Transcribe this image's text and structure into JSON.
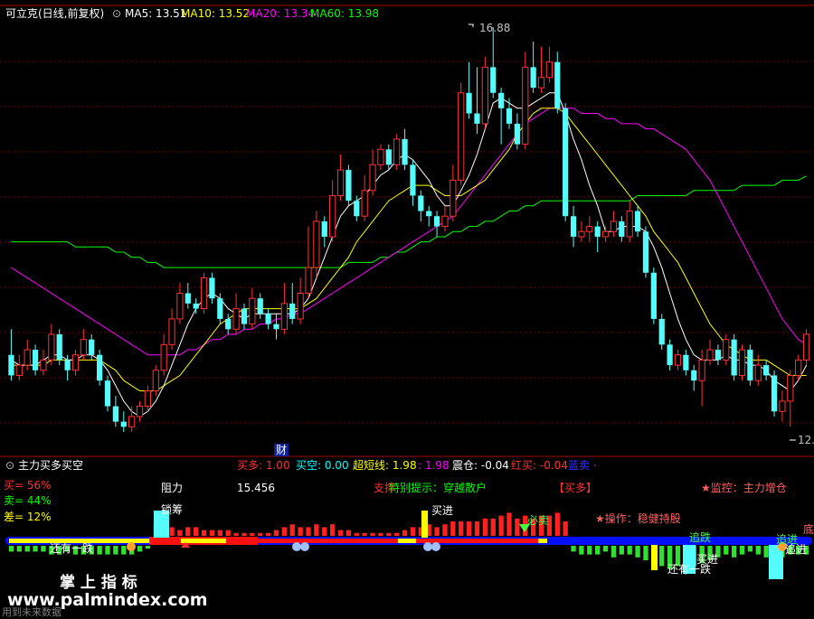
{
  "main_header": {
    "title": "可立克(日线,前复权)",
    "ma5": "MA5: 13.51",
    "ma10": "MA10: 13.52",
    "ma20": "MA20: 13.34",
    "ma60": "MA60: 13.98"
  },
  "sub_header": {
    "title": "主力买多买空",
    "items": [
      {
        "text": "买多: 1.00",
        "color": "#ff3030"
      },
      {
        "text": "买空: 0.00",
        "color": "#00ffff"
      },
      {
        "text": "超短线: 1.98",
        "color": "#ffff00"
      },
      {
        "text": ": 1.98",
        "color": "#ff00ff"
      },
      {
        "text": "震仓: -0.04",
        "color": "#ffffff"
      },
      {
        "text": "红买: -0.04",
        "color": "#ff3030"
      },
      {
        "text": "蓝卖",
        "color": "#3030ff"
      },
      {
        "text": "·",
        "color": "#ff00ff"
      }
    ]
  },
  "left_stats": {
    "buy": "买= 56%",
    "sell": "卖= 44%",
    "diff": "差= 12%"
  },
  "labels": {
    "resistance_label": "阻力",
    "resistance_value": "15.456",
    "support_label": "支撑",
    "hint": "特别提示：穿越散户",
    "buy_more": "【买多】",
    "monitor": "★监控：主力增仓",
    "operate": "★操作：稳健持股",
    "tag_finance": "财",
    "tag_buy_in_1": "买进",
    "tag_must_sell": "必卖",
    "tag_buy_in_2": "买进",
    "tag_still_fall_1": "还有一跌",
    "tag_still_fall_2": "还有一跌",
    "tag_chase": "追跌",
    "tag_chase_in": "追进",
    "tag_right_1": "追进",
    "tag_right_2": "底",
    "tag_lock": "锁筹",
    "watermark_title": "掌 上 指 标",
    "watermark_url": "www.palmindex.com",
    "footer": "用到未来数据"
  },
  "chart_data": {
    "type": "candlestick",
    "title": "可立克(日线,前复权)",
    "annotations": [
      {
        "text": "16.88",
        "kind": "high"
      },
      {
        "text": "12.",
        "kind": "low"
      }
    ],
    "colors": {
      "up": "#ff3232",
      "down": "#54fcfc",
      "ma5": "#ffffff",
      "ma10": "#ffff00",
      "ma20": "#ff00ff",
      "ma60": "#00ff00"
    },
    "candles": [
      [
        10.5,
        10.1,
        11.0,
        10.0
      ],
      [
        10.1,
        10.3,
        10.5,
        10.0
      ],
      [
        10.3,
        10.6,
        10.8,
        10.2
      ],
      [
        10.6,
        10.2,
        10.7,
        10.1
      ],
      [
        10.2,
        10.4,
        10.6,
        10.1
      ],
      [
        10.4,
        10.9,
        11.1,
        10.3
      ],
      [
        10.9,
        10.4,
        11.0,
        10.3
      ],
      [
        10.4,
        10.2,
        10.5,
        10.0
      ],
      [
        10.2,
        10.5,
        10.6,
        10.1
      ],
      [
        10.5,
        10.8,
        11.0,
        10.4
      ],
      [
        10.8,
        10.5,
        10.9,
        10.4
      ],
      [
        10.5,
        10.0,
        10.6,
        9.9
      ],
      [
        10.0,
        9.5,
        10.1,
        9.4
      ],
      [
        9.5,
        9.2,
        9.7,
        9.1
      ],
      [
        9.2,
        9.1,
        9.4,
        9.0
      ],
      [
        9.1,
        9.3,
        9.5,
        9.0
      ],
      [
        9.3,
        9.5,
        9.6,
        9.2
      ],
      [
        9.5,
        9.8,
        9.9,
        9.4
      ],
      [
        9.8,
        10.2,
        10.3,
        9.7
      ],
      [
        10.2,
        10.7,
        10.9,
        10.1
      ],
      [
        10.7,
        11.2,
        11.4,
        10.6
      ],
      [
        11.2,
        11.7,
        11.9,
        11.1
      ],
      [
        11.7,
        11.5,
        11.9,
        11.4
      ],
      [
        11.5,
        11.4,
        11.6,
        11.3
      ],
      [
        11.4,
        12.0,
        12.1,
        11.3
      ],
      [
        12.0,
        11.6,
        12.1,
        11.5
      ],
      [
        11.6,
        11.2,
        11.7,
        11.1
      ],
      [
        11.2,
        11.0,
        11.3,
        10.9
      ],
      [
        11.0,
        11.4,
        11.7,
        10.9
      ],
      [
        11.4,
        11.1,
        11.5,
        11.0
      ],
      [
        11.1,
        11.6,
        11.8,
        11.0
      ],
      [
        11.6,
        11.3,
        11.7,
        11.2
      ],
      [
        11.3,
        11.1,
        11.4,
        11.0
      ],
      [
        11.1,
        11.0,
        11.3,
        10.8
      ],
      [
        11.0,
        11.5,
        11.9,
        10.9
      ],
      [
        11.5,
        11.2,
        11.9,
        11.1
      ],
      [
        11.2,
        11.7,
        12.0,
        11.1
      ],
      [
        11.7,
        12.2,
        13.0,
        11.6
      ],
      [
        12.2,
        13.1,
        13.3,
        12.0
      ],
      [
        13.1,
        12.8,
        13.2,
        12.6
      ],
      [
        12.8,
        13.6,
        13.9,
        12.7
      ],
      [
        13.6,
        14.1,
        14.4,
        13.5
      ],
      [
        14.1,
        13.5,
        14.2,
        13.4
      ],
      [
        13.5,
        13.2,
        13.6,
        13.1
      ],
      [
        13.2,
        13.7,
        14.0,
        13.1
      ],
      [
        13.7,
        14.2,
        14.5,
        13.6
      ],
      [
        14.2,
        14.5,
        14.6,
        14.1
      ],
      [
        14.5,
        14.2,
        14.6,
        14.1
      ],
      [
        14.2,
        14.7,
        14.8,
        14.1
      ],
      [
        14.7,
        14.2,
        14.9,
        14.1
      ],
      [
        14.2,
        13.6,
        14.3,
        13.4
      ],
      [
        13.6,
        13.3,
        13.7,
        13.1
      ],
      [
        13.3,
        13.2,
        13.4,
        13.0
      ],
      [
        13.2,
        13.0,
        13.3,
        12.8
      ],
      [
        13.0,
        13.2,
        13.4,
        12.9
      ],
      [
        13.2,
        13.9,
        14.2,
        13.1
      ],
      [
        13.9,
        15.6,
        15.8,
        13.8
      ],
      [
        15.6,
        15.2,
        16.2,
        15.1
      ],
      [
        15.2,
        15.0,
        16.1,
        14.8
      ],
      [
        15.0,
        16.1,
        16.3,
        14.9
      ],
      [
        16.1,
        15.6,
        16.88,
        15.5
      ],
      [
        15.6,
        15.3,
        15.7,
        14.6
      ],
      [
        15.3,
        15.0,
        15.5,
        14.9
      ],
      [
        15.0,
        14.6,
        15.2,
        14.5
      ],
      [
        14.6,
        16.1,
        16.4,
        14.5
      ],
      [
        16.1,
        15.7,
        16.6,
        15.6
      ],
      [
        15.7,
        15.9,
        16.5,
        15.6
      ],
      [
        15.9,
        16.2,
        16.5,
        15.8
      ],
      [
        16.2,
        15.3,
        16.4,
        15.2
      ],
      [
        15.3,
        13.2,
        15.4,
        13.1
      ],
      [
        13.2,
        12.8,
        13.4,
        12.6
      ],
      [
        12.8,
        12.9,
        13.1,
        12.7
      ],
      [
        12.9,
        13.0,
        13.2,
        12.7
      ],
      [
        13.0,
        12.8,
        13.1,
        12.5
      ],
      [
        12.8,
        12.9,
        13.0,
        12.7
      ],
      [
        12.9,
        13.1,
        13.3,
        12.8
      ],
      [
        13.1,
        12.8,
        13.2,
        12.7
      ],
      [
        12.8,
        13.3,
        13.5,
        12.7
      ],
      [
        13.3,
        12.9,
        13.4,
        12.8
      ],
      [
        12.9,
        12.1,
        13.0,
        12.0
      ],
      [
        12.1,
        11.2,
        12.2,
        11.1
      ],
      [
        11.2,
        10.7,
        11.3,
        10.6
      ],
      [
        10.7,
        10.3,
        10.8,
        10.2
      ],
      [
        10.3,
        10.5,
        10.6,
        10.2
      ],
      [
        10.5,
        10.2,
        10.6,
        10.1
      ],
      [
        10.2,
        10.0,
        10.3,
        9.8
      ],
      [
        10.0,
        10.4,
        10.6,
        9.5
      ],
      [
        10.4,
        10.6,
        10.8,
        10.3
      ],
      [
        10.6,
        10.4,
        10.7,
        10.3
      ],
      [
        10.4,
        10.8,
        10.9,
        10.3
      ],
      [
        10.8,
        10.1,
        10.9,
        10.0
      ],
      [
        10.1,
        10.6,
        10.7,
        10.0
      ],
      [
        10.6,
        10.0,
        10.7,
        9.9
      ],
      [
        10.0,
        10.3,
        10.5,
        9.9
      ],
      [
        10.3,
        10.1,
        10.4,
        10.0
      ],
      [
        10.1,
        9.4,
        10.2,
        9.3
      ],
      [
        9.4,
        9.6,
        9.8,
        9.2
      ],
      [
        9.6,
        10.1,
        10.2,
        9.1
      ],
      [
        10.1,
        10.4,
        10.5,
        10.0
      ],
      [
        10.4,
        10.9,
        11.0,
        10.3
      ]
    ],
    "ma5": [
      10.4,
      10.3,
      10.3,
      10.3,
      10.4,
      10.5,
      10.5,
      10.4,
      10.4,
      10.5,
      10.5,
      10.4,
      10.2,
      9.9,
      9.6,
      9.4,
      9.3,
      9.4,
      9.6,
      9.9,
      10.3,
      10.7,
      11.1,
      11.4,
      11.6,
      11.7,
      11.6,
      11.4,
      11.3,
      11.2,
      11.3,
      11.3,
      11.3,
      11.3,
      11.3,
      11.3,
      11.4,
      11.6,
      12.0,
      12.4,
      12.8,
      13.2,
      13.4,
      13.5,
      13.6,
      13.8,
      14.0,
      14.1,
      14.3,
      14.4,
      14.3,
      14.1,
      13.9,
      13.6,
      13.4,
      13.4,
      13.7,
      14.0,
      14.4,
      14.9,
      15.4,
      15.5,
      15.4,
      15.3,
      15.3,
      15.4,
      15.5,
      15.6,
      15.6,
      15.2,
      14.7,
      14.3,
      13.8,
      13.4,
      12.9,
      12.9,
      13.0,
      13.0,
      13.0,
      12.9,
      12.6,
      12.2,
      11.7,
      11.2,
      10.8,
      10.5,
      10.4,
      10.4,
      10.4,
      10.5,
      10.4,
      10.4,
      10.3,
      10.3,
      10.2,
      10.0,
      9.9,
      9.8,
      10.0,
      10.3
    ],
    "ma10": [
      10.3,
      10.3,
      10.3,
      10.3,
      10.3,
      10.4,
      10.4,
      10.4,
      10.4,
      10.4,
      10.4,
      10.4,
      10.3,
      10.2,
      10.0,
      9.9,
      9.8,
      9.8,
      9.8,
      9.9,
      10.0,
      10.1,
      10.3,
      10.5,
      10.7,
      10.9,
      11.1,
      11.2,
      11.3,
      11.4,
      11.4,
      11.4,
      11.4,
      11.4,
      11.4,
      11.4,
      11.4,
      11.5,
      11.6,
      11.8,
      12.0,
      12.2,
      12.4,
      12.7,
      12.9,
      13.1,
      13.3,
      13.5,
      13.6,
      13.7,
      13.8,
      13.8,
      13.8,
      13.7,
      13.6,
      13.6,
      13.6,
      13.7,
      13.8,
      13.9,
      14.1,
      14.3,
      14.5,
      14.8,
      15.0,
      15.2,
      15.3,
      15.3,
      15.3,
      15.2,
      15.0,
      14.8,
      14.6,
      14.4,
      14.2,
      14.0,
      13.8,
      13.6,
      13.4,
      13.2,
      12.9,
      12.7,
      12.5,
      12.3,
      12.0,
      11.7,
      11.4,
      11.1,
      10.9,
      10.7,
      10.6,
      10.5,
      10.4,
      10.4,
      10.4,
      10.3,
      10.2,
      10.1,
      10.1,
      10.1
    ],
    "ma20": [
      12.2,
      12.1,
      12.0,
      11.9,
      11.8,
      11.7,
      11.6,
      11.5,
      11.4,
      11.3,
      11.2,
      11.1,
      11.0,
      10.9,
      10.8,
      10.7,
      10.6,
      10.5,
      10.5,
      10.5,
      10.5,
      10.5,
      10.6,
      10.6,
      10.7,
      10.8,
      10.8,
      10.9,
      10.9,
      11.0,
      11.0,
      11.1,
      11.1,
      11.2,
      11.2,
      11.3,
      11.3,
      11.4,
      11.5,
      11.6,
      11.7,
      11.8,
      11.9,
      12.0,
      12.1,
      12.2,
      12.3,
      12.4,
      12.5,
      12.6,
      12.7,
      12.8,
      12.9,
      13.0,
      13.1,
      13.2,
      13.4,
      13.6,
      13.8,
      14.0,
      14.2,
      14.4,
      14.6,
      14.8,
      15.0,
      15.1,
      15.2,
      15.3,
      15.3,
      15.3,
      15.3,
      15.2,
      15.2,
      15.2,
      15.1,
      15.1,
      15.0,
      15.0,
      15.0,
      14.9,
      14.9,
      14.8,
      14.7,
      14.6,
      14.5,
      14.3,
      14.1,
      13.9,
      13.6,
      13.3,
      13.0,
      12.7,
      12.4,
      12.1,
      11.8,
      11.5,
      11.2,
      11.0,
      10.8,
      10.7
    ],
    "ma60": [
      12.7,
      12.7,
      12.7,
      12.7,
      12.7,
      12.7,
      12.7,
      12.7,
      12.6,
      12.6,
      12.6,
      12.6,
      12.6,
      12.5,
      12.5,
      12.4,
      12.4,
      12.3,
      12.3,
      12.2,
      12.2,
      12.2,
      12.2,
      12.2,
      12.2,
      12.2,
      12.2,
      12.2,
      12.2,
      12.2,
      12.2,
      12.2,
      12.2,
      12.2,
      12.2,
      12.2,
      12.2,
      12.2,
      12.2,
      12.2,
      12.2,
      12.2,
      12.3,
      12.3,
      12.3,
      12.3,
      12.4,
      12.4,
      12.5,
      12.5,
      12.6,
      12.7,
      12.7,
      12.8,
      12.8,
      12.9,
      12.9,
      13.0,
      13.0,
      13.1,
      13.1,
      13.2,
      13.3,
      13.3,
      13.4,
      13.4,
      13.5,
      13.5,
      13.5,
      13.5,
      13.5,
      13.5,
      13.5,
      13.5,
      13.5,
      13.5,
      13.5,
      13.5,
      13.6,
      13.6,
      13.6,
      13.6,
      13.6,
      13.6,
      13.6,
      13.7,
      13.7,
      13.7,
      13.7,
      13.7,
      13.7,
      13.8,
      13.8,
      13.8,
      13.8,
      13.8,
      13.9,
      13.9,
      13.9,
      13.98
    ],
    "volume_bars": [
      -2,
      -2,
      -2,
      -2,
      -2,
      -3,
      -3,
      -2,
      -3,
      -3,
      -3,
      -3,
      -3,
      -3,
      -3,
      -3,
      -2,
      -1,
      4,
      4,
      3,
      2,
      3,
      3,
      2,
      2,
      2,
      2,
      1,
      1,
      1,
      1,
      1,
      2,
      3,
      4,
      3,
      3,
      4,
      3,
      4,
      2,
      2,
      1,
      1,
      1,
      1,
      1,
      1,
      2,
      3,
      3,
      4,
      3,
      4,
      5,
      5,
      5,
      5,
      6,
      6,
      7,
      8,
      6,
      7,
      6,
      7,
      7,
      8,
      5,
      -2,
      -3,
      -3,
      -3,
      -2,
      -4,
      -3,
      -3,
      -4,
      -5,
      -6,
      -7,
      -8,
      -7,
      -8,
      -7,
      -6,
      -5,
      -4,
      -3,
      -4,
      -3,
      -2,
      -3,
      -4,
      -5,
      -4,
      -3,
      -3,
      -3
    ]
  }
}
